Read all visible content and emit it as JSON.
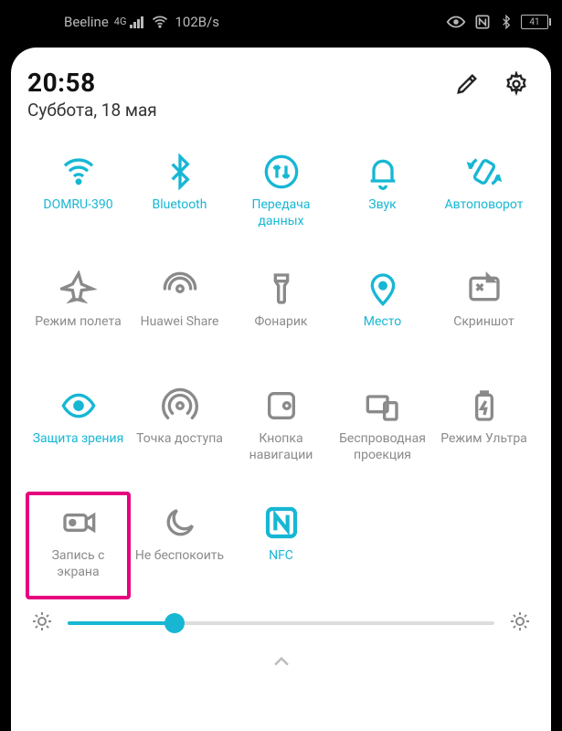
{
  "status": {
    "carrier": "Beeline",
    "net_type_top": "4G",
    "speed": "102B/s",
    "battery_pct": "41"
  },
  "header": {
    "time": "20:58",
    "date": "Суббота, 18 мая"
  },
  "tiles": [
    {
      "id": "wifi",
      "label": "DOMRU-390",
      "active": true,
      "icon": "wifi-icon"
    },
    {
      "id": "bluetooth",
      "label": "Bluetooth",
      "active": true,
      "icon": "bluetooth-icon"
    },
    {
      "id": "mobile-data",
      "label": "Передача данных",
      "active": true,
      "icon": "data-transfer-icon"
    },
    {
      "id": "sound",
      "label": "Звук",
      "active": true,
      "icon": "bell-icon"
    },
    {
      "id": "auto-rotate",
      "label": "Автоповорот",
      "active": true,
      "icon": "auto-rotate-icon"
    },
    {
      "id": "airplane",
      "label": "Режим полета",
      "active": false,
      "icon": "airplane-icon"
    },
    {
      "id": "huawei-share",
      "label": "Huawei Share",
      "active": false,
      "icon": "share-icon"
    },
    {
      "id": "flashlight",
      "label": "Фонарик",
      "active": false,
      "icon": "flashlight-icon"
    },
    {
      "id": "location",
      "label": "Место",
      "active": true,
      "icon": "location-icon"
    },
    {
      "id": "screenshot",
      "label": "Скриншот",
      "active": false,
      "icon": "screenshot-icon"
    },
    {
      "id": "eye-comfort",
      "label": "Защита зрения",
      "active": true,
      "icon": "eye-icon"
    },
    {
      "id": "hotspot",
      "label": "Точка доступа",
      "active": false,
      "icon": "hotspot-icon"
    },
    {
      "id": "nav-button",
      "label": "Кнопка навигации",
      "active": false,
      "icon": "nav-dock-icon"
    },
    {
      "id": "wireless-proj",
      "label": "Беспроводная проекция",
      "active": false,
      "icon": "projection-icon"
    },
    {
      "id": "ultra-mode",
      "label": "Режим Ультра",
      "active": false,
      "icon": "battery-ultra-icon"
    },
    {
      "id": "screen-record",
      "label": "Запись с экрана",
      "active": false,
      "icon": "record-icon",
      "highlighted": true
    },
    {
      "id": "dnd",
      "label": "Не беспокоить",
      "active": false,
      "icon": "moon-icon"
    },
    {
      "id": "nfc",
      "label": "NFC",
      "active": true,
      "icon": "nfc-icon"
    }
  ],
  "brightness": {
    "percent": 25
  }
}
